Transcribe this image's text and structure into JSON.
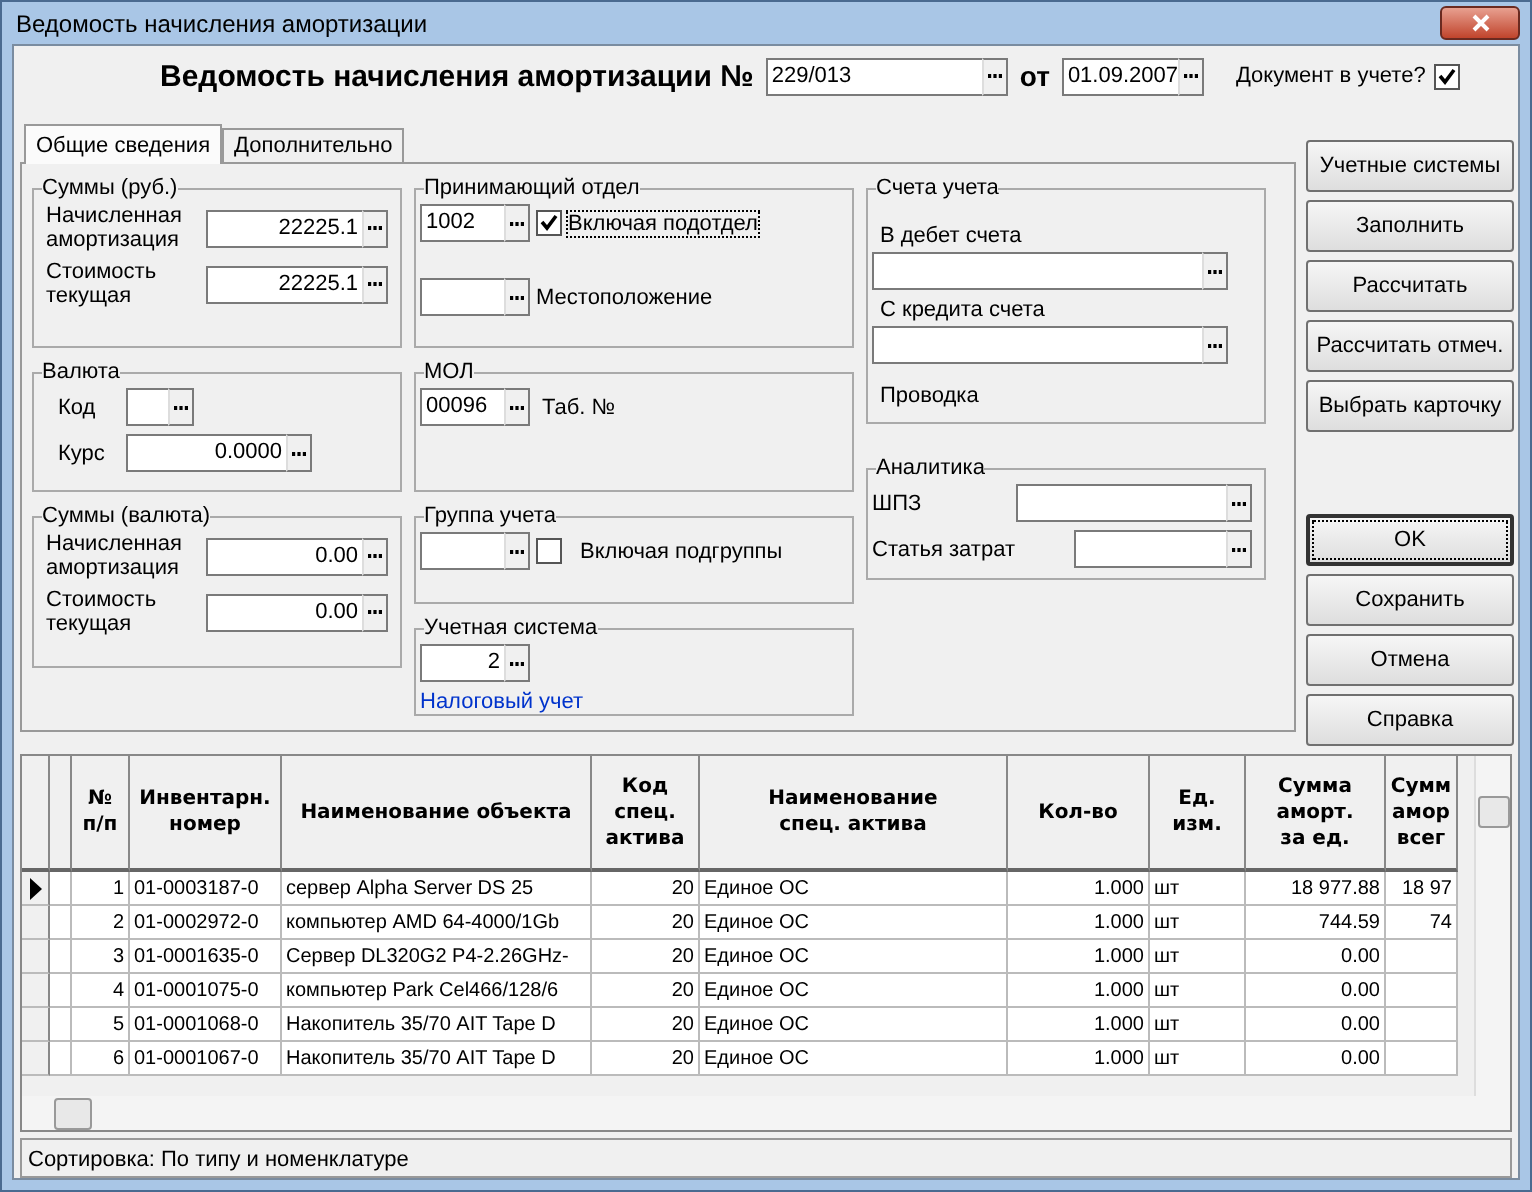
{
  "window": {
    "title": "Ведомость начисления амортизации"
  },
  "header": {
    "title": "Ведомость начисления амортизации №",
    "number": "229/013",
    "date_label": "от",
    "date": "01.09.2007",
    "posted_label": "Документ в учете?",
    "posted": true
  },
  "tabs": [
    {
      "label": "Общие сведения",
      "selected": true
    },
    {
      "label": "Дополнительно",
      "selected": false
    }
  ],
  "sums_rub": {
    "title": "Суммы (руб.)",
    "fields": [
      {
        "label": "Начисленная амортизация",
        "value": "22225.1"
      },
      {
        "label": "Стоимость текущая",
        "value": "22225.1"
      }
    ]
  },
  "currency": {
    "title": "Валюта",
    "code_label": "Код",
    "rate_label": "Курс",
    "rate": "0.0000"
  },
  "sums_cur": {
    "title": "Суммы (валюта)",
    "fields": [
      {
        "label": "Начисленная амортизация",
        "value": "0.00"
      },
      {
        "label": "Стоимость текущая",
        "value": "0.00"
      }
    ]
  },
  "department": {
    "title": "Принимающий отдел",
    "code": "1002",
    "include_label": "Включая подотдел",
    "include": true,
    "location_label": "Местоположение"
  },
  "mol": {
    "title": "МОЛ",
    "code": "00096",
    "tab_label": "Таб. №"
  },
  "group": {
    "title": "Группа учета",
    "include_label": "Включая подгруппы",
    "include": false
  },
  "system": {
    "title": "Учетная система",
    "code": "2",
    "name": "Налоговый учет"
  },
  "accounts": {
    "title": "Счета учета",
    "debit_label": "В дебет счета",
    "credit_label": "С кредита счета",
    "posting_label": "Проводка"
  },
  "analytics": {
    "title": "Аналитика",
    "fields": [
      {
        "label": "ШПЗ"
      },
      {
        "label": "Статья затрат"
      }
    ]
  },
  "buttons_top": [
    {
      "label": "Учетные системы",
      "focused": false
    },
    {
      "label": "Заполнить",
      "focused": false
    },
    {
      "label": "Рассчитать",
      "focused": false
    },
    {
      "label": "Рассчитать отмеч.",
      "focused": false
    },
    {
      "label": "Выбрать карточку",
      "focused": false
    }
  ],
  "buttons_bottom": [
    {
      "label": "OK",
      "focused": true
    },
    {
      "label": "Сохранить",
      "focused": false
    },
    {
      "label": "Отмена",
      "focused": false
    },
    {
      "label": "Справка",
      "focused": false
    }
  ],
  "table": {
    "columns": [
      "№\nп/п",
      "Инвентарн.\nномер",
      "Наименование объекта",
      "Код\nспец.\nактива",
      "Наименование\nспец. актива",
      "Кол-во",
      "Ед.\nизм.",
      "Сумма\nаморт.\nза ед.",
      "Сумм\nамор\nвсег"
    ],
    "rows": [
      {
        "selected": true,
        "cells": [
          "1",
          "01-0003187-0",
          "сервер Alpha Server DS 25",
          "20",
          "Единое ОС",
          "1.000",
          "шт",
          "18 977.88",
          "18 97"
        ]
      },
      {
        "selected": false,
        "cells": [
          "2",
          "01-0002972-0",
          "компьютер AMD 64-4000/1Gb",
          "20",
          "Единое ОС",
          "1.000",
          "шт",
          "744.59",
          "74"
        ]
      },
      {
        "selected": false,
        "cells": [
          "3",
          "01-0001635-0",
          "Сервер DL320G2 P4-2.26GHz-",
          "20",
          "Единое ОС",
          "1.000",
          "шт",
          "0.00"
        ]
      },
      {
        "selected": false,
        "cells": [
          "4",
          "01-0001075-0",
          "компьютер Park Cel466/128/6",
          "20",
          "Единое ОС",
          "1.000",
          "шт",
          "0.00"
        ]
      },
      {
        "selected": false,
        "cells": [
          "5",
          "01-0001068-0",
          "Накопитель 35/70 AIT Tape D",
          "20",
          "Единое ОС",
          "1.000",
          "шт",
          "0.00"
        ]
      },
      {
        "selected": false,
        "cells": [
          "6",
          "01-0001067-0",
          "Накопитель 35/70 AIT Tape D",
          "20",
          "Единое ОС",
          "1.000",
          "шт",
          "0.00"
        ]
      }
    ]
  },
  "status_bar": "Сортировка: По типу и номенклатуре"
}
